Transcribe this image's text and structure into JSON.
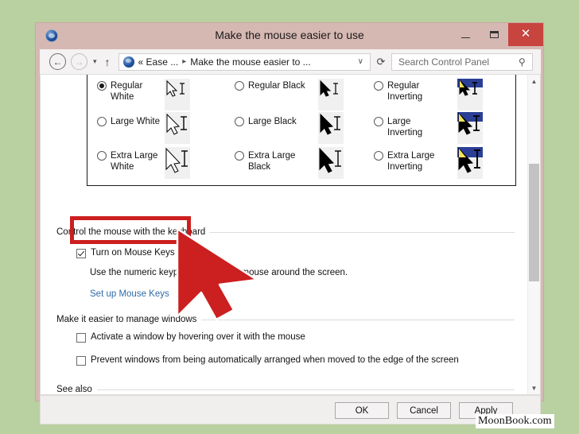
{
  "window": {
    "title": "Make the mouse easier to use",
    "icon": "ease-of-access-icon",
    "minimize_label": "–",
    "maximize_label": "□",
    "close_label": "✕"
  },
  "nav": {
    "back_icon": "←",
    "forward_icon": "→",
    "history_icon": "▾",
    "up_icon": "↑",
    "breadcrumb_prefix": "« Ease ...",
    "breadcrumb_sep": "▸",
    "breadcrumb_current": "Make the mouse easier to ...",
    "dropdown_icon": "∨",
    "refresh_icon": "⟳"
  },
  "search": {
    "placeholder": "Search Control Panel",
    "icon": "search-icon"
  },
  "cursor_schemes": {
    "columns": [
      {
        "items": [
          {
            "label": "Regular\nWhite",
            "selected": true,
            "style": "white"
          },
          {
            "label": "Large White",
            "selected": false,
            "style": "white"
          },
          {
            "label": "Extra Large\nWhite",
            "selected": false,
            "style": "white"
          }
        ]
      },
      {
        "items": [
          {
            "label": "Regular Black",
            "selected": false,
            "style": "black"
          },
          {
            "label": "Large Black",
            "selected": false,
            "style": "black"
          },
          {
            "label": "Extra Large\nBlack",
            "selected": false,
            "style": "black"
          }
        ]
      },
      {
        "items": [
          {
            "label": "Regular\nInverting",
            "selected": false,
            "style": "inverting"
          },
          {
            "label": "Large\nInverting",
            "selected": false,
            "style": "inverting"
          },
          {
            "label": "Extra Large\nInverting",
            "selected": false,
            "style": "inverting"
          }
        ]
      }
    ]
  },
  "sections": {
    "keyboard": {
      "heading": "Control the mouse with the keyboard",
      "mouse_keys_label": "Turn on Mouse Keys",
      "mouse_keys_checked": true,
      "hint": "Use the numeric keypad to move the mouse around the screen.",
      "setup_link": "Set up Mouse Keys"
    },
    "windows": {
      "heading": "Make it easier to manage windows",
      "activate_label": "Activate a window by hovering over it with the mouse",
      "activate_checked": false,
      "prevent_label": "Prevent windows from being automatically arranged when moved to the edge of the screen",
      "prevent_checked": false
    },
    "see_also": {
      "heading": "See also"
    }
  },
  "buttons": {
    "ok": "OK",
    "cancel": "Cancel",
    "apply": "Apply"
  },
  "annotations": {
    "highlight_color": "#cc1f1f",
    "arrow_color": "#cc1f1f",
    "highlight_target": "Turn on Mouse Keys"
  },
  "watermark": {
    "text": "MoonBook.com"
  }
}
